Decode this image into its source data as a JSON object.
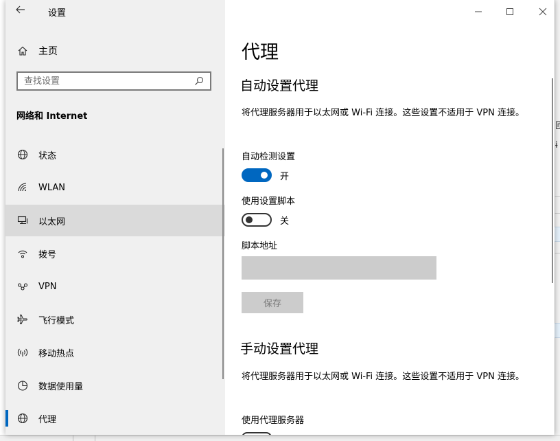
{
  "window": {
    "title": "设置"
  },
  "sidebar": {
    "home_label": "主页",
    "search_placeholder": "查找设置",
    "section_title": "网络和 Internet",
    "items": [
      {
        "label": "状态",
        "icon": "globe-icon"
      },
      {
        "label": "WLAN",
        "icon": "wifi-icon"
      },
      {
        "label": "以太网",
        "icon": "ethernet-icon"
      },
      {
        "label": "拨号",
        "icon": "dialup-icon"
      },
      {
        "label": "VPN",
        "icon": "vpn-icon"
      },
      {
        "label": "飞行模式",
        "icon": "airplane-icon"
      },
      {
        "label": "移动热点",
        "icon": "hotspot-icon"
      },
      {
        "label": "数据使用量",
        "icon": "data-usage-icon"
      },
      {
        "label": "代理",
        "icon": "globe-icon"
      }
    ]
  },
  "main": {
    "title": "代理",
    "auto": {
      "heading": "自动设置代理",
      "description": "将代理服务器用于以太网或 Wi-Fi 连接。这些设置不适用于 VPN 连接。",
      "detect_label": "自动检测设置",
      "detect_state": "开",
      "detect_on": true,
      "script_label": "使用设置脚本",
      "script_state": "关",
      "script_on": false,
      "address_label": "脚本地址",
      "address_value": "",
      "save_label": "保存"
    },
    "manual": {
      "heading": "手动设置代理",
      "description": "将代理服务器用于以太网或 Wi-Fi 连接。这些设置不适用于 VPN 连接。",
      "proxy_label": "使用代理服务器"
    }
  },
  "colors": {
    "accent": "#0067c0",
    "sidebar_bg": "#f0f0f0",
    "hover_bg": "#dadada",
    "disabled_bg": "#cccccc"
  }
}
